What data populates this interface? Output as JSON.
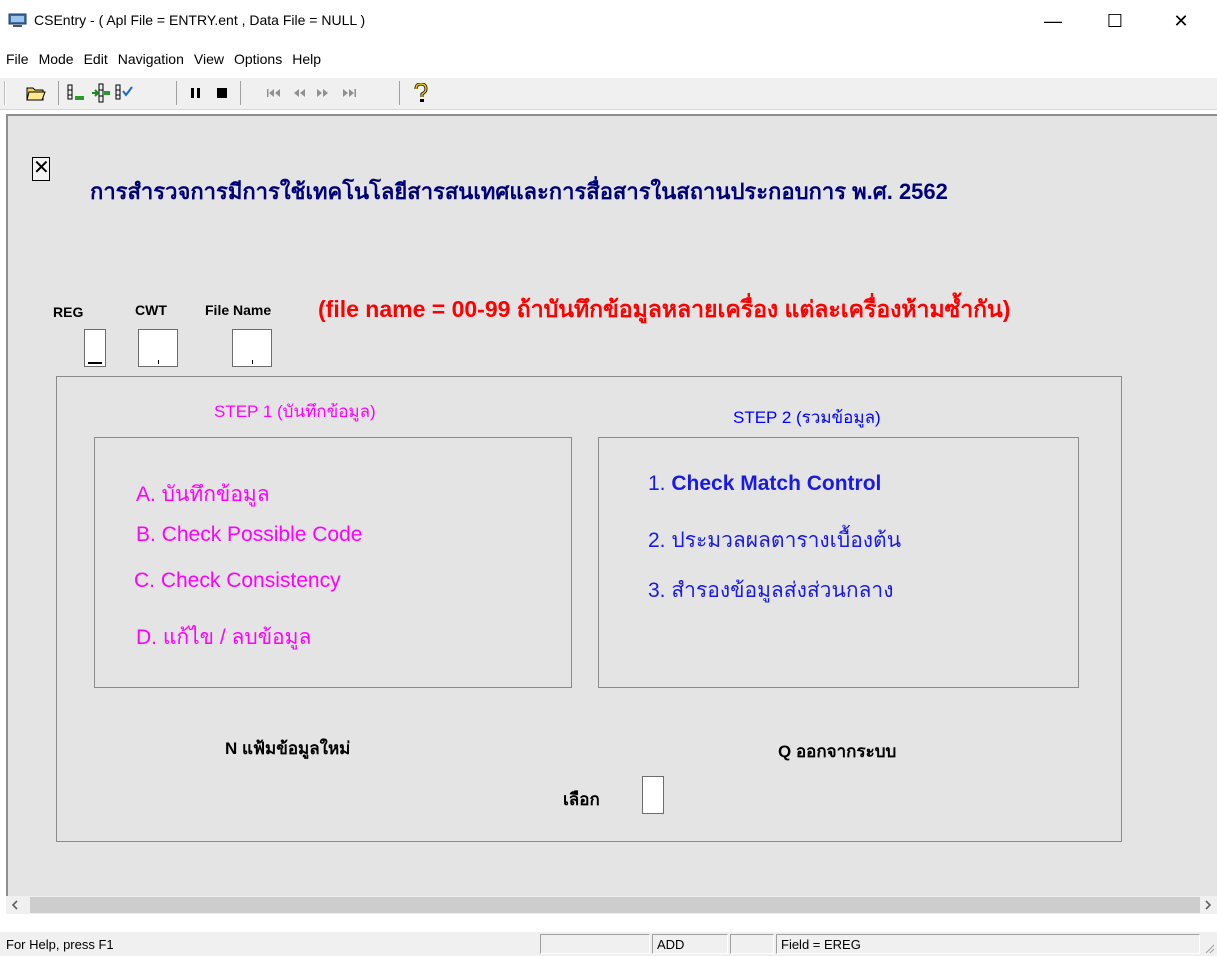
{
  "window": {
    "title": "CSEntry - ( Apl File = ENTRY.ent , Data File = NULL )",
    "min_glyph": "—",
    "max_glyph": "☐",
    "close_glyph": "✕"
  },
  "menu": [
    "File",
    "Mode",
    "Edit",
    "Navigation",
    "View",
    "Options",
    "Help"
  ],
  "toolbar": {
    "buttons": [
      "open-folder-icon",
      "add-case-icon",
      "insert-case-icon",
      "verify-case-icon",
      "pause-icon",
      "stop-icon",
      "first-icon",
      "previous-icon",
      "next-icon",
      "last-icon",
      "help-icon"
    ]
  },
  "form": {
    "close_glyph": "✕",
    "title": "การสำรวจการมีการใช้เทคโนโลยีสารสนเทศและการสื่อสารในสถานประกอบการ พ.ศ. 2562",
    "labels": {
      "reg": "REG",
      "cwt": "CWT",
      "file_name": "File Name"
    },
    "note": "(file name = 00-99 ถ้าบันทึกข้อมูลหลายเครื่อง แต่ละเครื่องห้ามซ้ำกัน)",
    "step1": {
      "heading": "STEP 1 (บันทึกข้อมูล)",
      "options": [
        "A. บันทึกข้อมูล",
        "B.  Check Possible Code",
        "C.  Check Consistency",
        "D. แก้ไข / ลบข้อมูล"
      ]
    },
    "step2": {
      "heading": "STEP 2 (รวมข้อมูล)",
      "options": [
        {
          "num": "1.",
          "text": "Check Match Control"
        },
        {
          "num": "2.",
          "text": "ประมวลผลตารางเบื้องต้น"
        },
        {
          "num": "3.",
          "text": "สำรองข้อมูลส่งส่วนกลาง"
        }
      ]
    },
    "new_file": "N  แฟ้มข้อมูลใหม่",
    "quit": "Q  ออกจากระบบ",
    "select_label": "เลือก"
  },
  "status": {
    "help": "For Help, press F1",
    "pane1": "",
    "mode": "ADD",
    "pane3": "",
    "field": "Field = EREG"
  },
  "colors": {
    "title_blue": "#00007a",
    "note_red": "#ff0000",
    "step1_pink": "#ff00ff",
    "step2_blue": "#0000ff"
  }
}
